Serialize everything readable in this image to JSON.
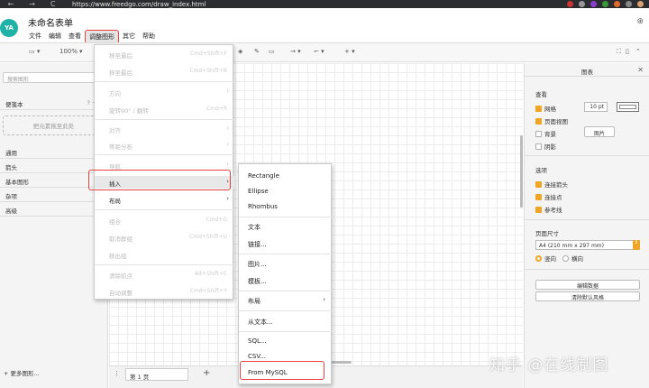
{
  "browser": {
    "url": "https://www.freedgo.com/draw_index.html",
    "nav": [
      "←",
      "→",
      "C"
    ]
  },
  "app": {
    "logo": "YA",
    "title": "未命名表单",
    "globe_icon": "globe-icon"
  },
  "menubar": [
    "文件",
    "编辑",
    "查看",
    "调整图形",
    "其它",
    "帮助"
  ],
  "toolbar": {
    "zoom": "100%",
    "plus": "+"
  },
  "sidebar": {
    "search_placeholder": "搜索图形",
    "scratchpad": "便笺本",
    "scratchpad_actions": "? + ✎",
    "dropzone": "把元素拖至此处",
    "sections": [
      "通用",
      "箭头",
      "基本图形",
      "杂项",
      "高级"
    ],
    "more_shapes": "+ 更多图形..."
  },
  "pagebar": {
    "menu_glyph": "⋮",
    "page_tab": "第 1 页",
    "add": "+"
  },
  "arrange_menu": {
    "items": [
      {
        "label": "移至最后",
        "shortcut": "Cmd+Shift+F",
        "enabled": false
      },
      {
        "label": "移至最后",
        "shortcut": "Cmd+Shift+B",
        "enabled": false
      },
      {
        "label": "方向",
        "submenu": true,
        "enabled": false
      },
      {
        "label": "旋转90° / 翻转",
        "shortcut": "Cmd+R",
        "enabled": false
      },
      {
        "label": "对齐",
        "submenu": true,
        "enabled": false
      },
      {
        "label": "等距分布",
        "submenu": true,
        "enabled": false
      },
      {
        "label": "导航",
        "submenu": true,
        "enabled": false
      },
      {
        "label": "插入",
        "submenu": true,
        "enabled": true
      },
      {
        "label": "布局",
        "submenu": true,
        "enabled": true
      },
      {
        "label": "组合",
        "shortcut": "Cmd+G",
        "enabled": false
      },
      {
        "label": "取消群组",
        "shortcut": "Cmd+Shift+U",
        "enabled": false
      },
      {
        "label": "移出组",
        "enabled": false
      },
      {
        "label": "清除航点",
        "shortcut": "Alt+Shift+C",
        "enabled": false
      },
      {
        "label": "自动调整",
        "shortcut": "Cmd+Shift+Y",
        "enabled": false
      }
    ]
  },
  "insert_menu": {
    "items": [
      "Rectangle",
      "Ellipse",
      "Rhombus",
      "文本",
      "链接...",
      "图片...",
      "模板...",
      "布局",
      "从文本...",
      "SQL...",
      "CSV...",
      "From MySQL"
    ]
  },
  "format_panel": {
    "title": "图表",
    "view_label": "查看",
    "grid": "网格",
    "grid_size": "10 pt",
    "page_view": "页面视图",
    "background": "背景",
    "image_button": "图片",
    "shadow": "阴影",
    "options_label": "选项",
    "connect_arrows": "连接箭头",
    "connection_points": "连接点",
    "guides": "参考线",
    "page_size_label": "页面尺寸",
    "page_size_value": "A4 (210 mm x 297 mm)",
    "portrait": "竖向",
    "landscape": "横向",
    "edit_data": "编辑数据",
    "clear_style": "清除默认风格"
  },
  "watermark": "知乎 @在线制图",
  "colors": {
    "accent": "#f0a524",
    "highlight_border": "#e8423f",
    "logo": "#1fb3a8"
  }
}
